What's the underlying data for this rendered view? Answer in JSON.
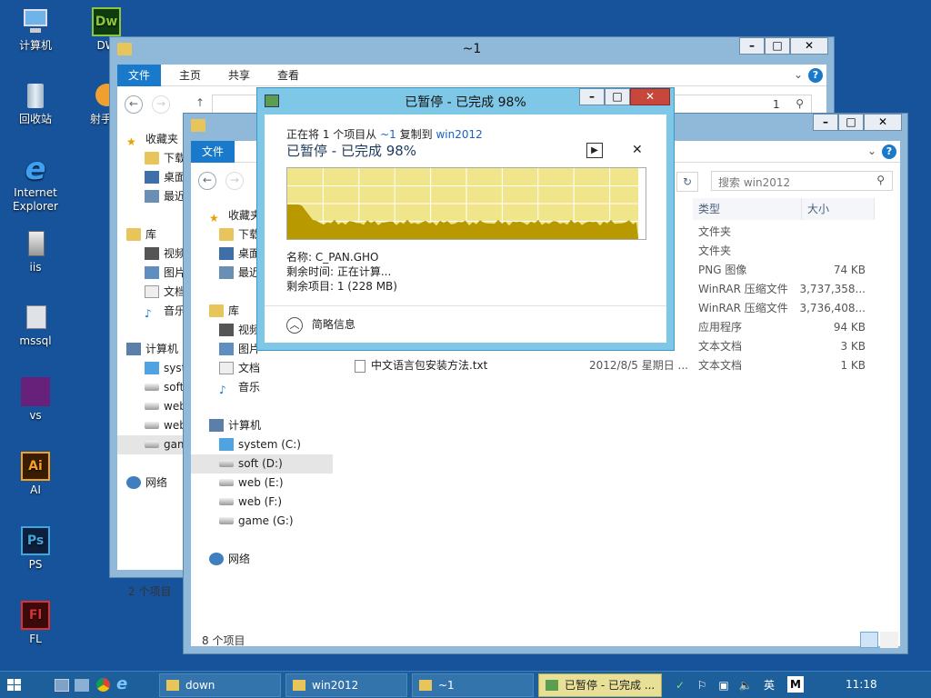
{
  "desktop": {
    "icons": [
      {
        "label": "计算机"
      },
      {
        "label": "DW"
      },
      {
        "label": "回收站"
      },
      {
        "label": "射手影"
      },
      {
        "label": "Internet Explorer"
      },
      {
        "label": "iis"
      },
      {
        "label": "mssql"
      },
      {
        "label": "vs"
      },
      {
        "label": "AI"
      },
      {
        "label": "PS"
      },
      {
        "label": "FL"
      }
    ]
  },
  "back_window": {
    "title": "~1",
    "tabs": [
      "文件",
      "主页",
      "共享",
      "查看"
    ],
    "address_tail": "1",
    "tree": [
      "收藏夹",
      "下载",
      "桌面",
      "最近",
      "库",
      "视频",
      "图片",
      "文档",
      "音乐",
      "计算机",
      "syst",
      "soft",
      "web",
      "web",
      "gam",
      "网络"
    ],
    "status": "2 个项目"
  },
  "front_window": {
    "title": "",
    "tabs": [
      "文件"
    ],
    "search_placeholder": "搜索 win2012",
    "columns": {
      "type": "类型",
      "size": "大小"
    },
    "tree": {
      "favorites": "收藏夹",
      "fav_items": [
        "下载",
        "桌面",
        "最近"
      ],
      "library": "库",
      "lib_items": [
        "视频",
        "图片",
        "文档",
        "音乐"
      ],
      "computer": "计算机",
      "drives": [
        "system (C:)",
        "soft (D:)",
        "web (E:)",
        "web (F:)",
        "game (G:)"
      ],
      "network": "网络"
    },
    "files": [
      {
        "name": "",
        "date": "",
        "type": "文件夹",
        "size": ""
      },
      {
        "name": "",
        "date": "",
        "type": "文件夹",
        "size": ""
      },
      {
        "name": "",
        "date": "",
        "type": "PNG 图像",
        "size": "74 KB"
      },
      {
        "name": "",
        "date": "",
        "type": "WinRAR 压缩文件",
        "size": "3,737,358..."
      },
      {
        "name": "",
        "date": "",
        "type": "WinRAR 压缩文件",
        "size": "3,736,408..."
      },
      {
        "name": "",
        "date": "",
        "type": "应用程序",
        "size": "94 KB"
      },
      {
        "name": "",
        "date": "",
        "type": "文本文档",
        "size": "3 KB"
      },
      {
        "name": "中文语言包安装方法.txt",
        "date": "2012/8/5 星期日 ...",
        "type": "文本文档",
        "size": "1 KB"
      }
    ],
    "status": "8 个项目"
  },
  "copy_dialog": {
    "title": "已暂停 - 已完成 98%",
    "line_prefix": "正在将 1 个项目从",
    "source": "~1",
    "line_mid": "复制到",
    "dest": "win2012",
    "heading": "已暂停 - 已完成 98%",
    "progress_percent": 98,
    "name_label": "名称: C_PAN.GHO",
    "time_label": "剩余时间: 正在计算...",
    "items_label": "剩余项目: 1 (228 MB)",
    "summary_label": "简略信息",
    "colors": {
      "chart_bg": "#f0e58a",
      "chart_fill": "#b89a00"
    }
  },
  "taskbar": {
    "items": [
      "down",
      "win2012",
      "~1",
      "已暂停 - 已完成 ..."
    ],
    "ime": "英",
    "ime2": "M",
    "clock": "11:18"
  }
}
